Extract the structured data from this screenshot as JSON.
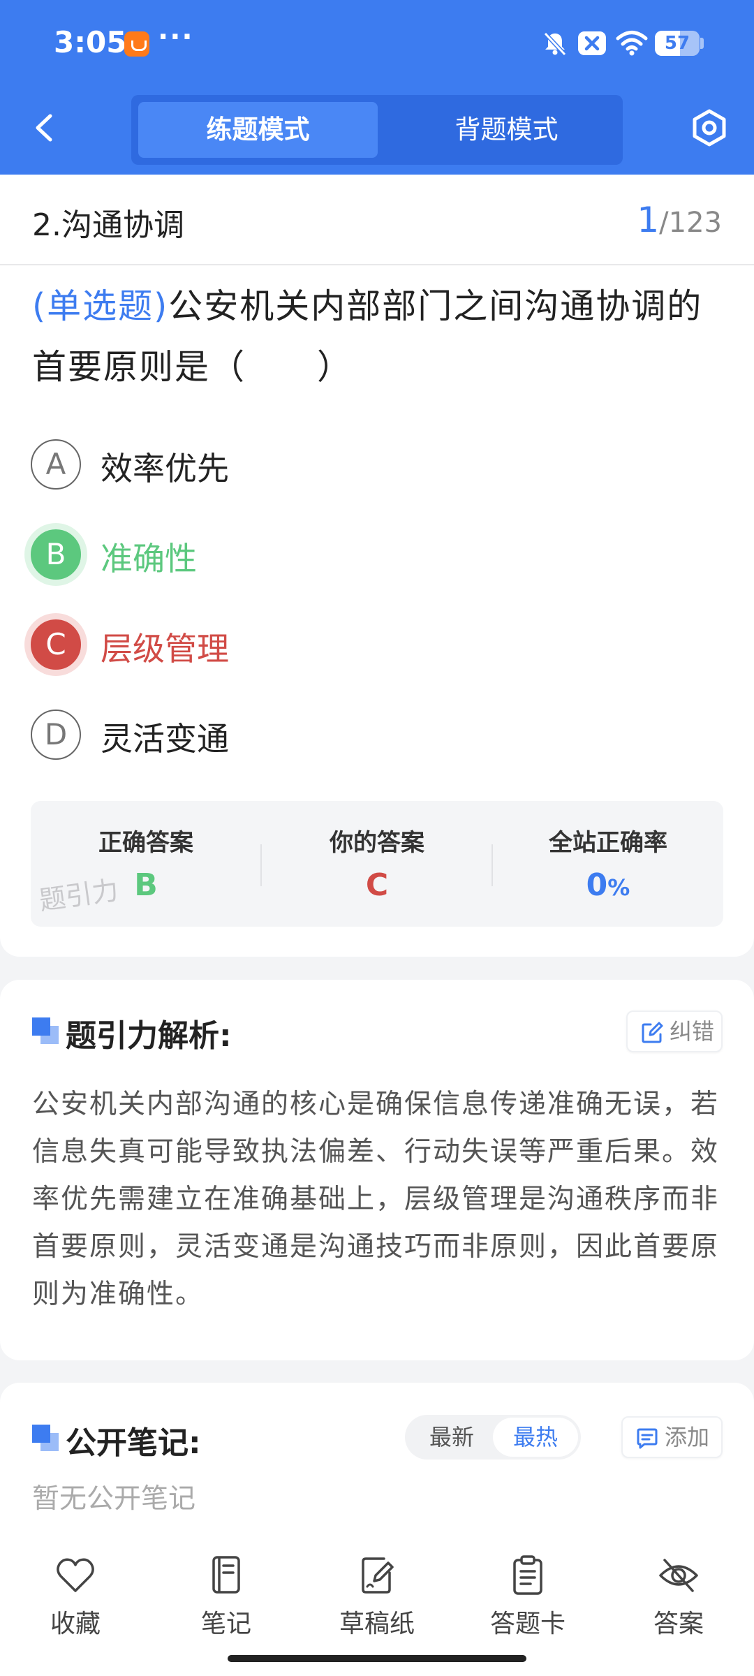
{
  "status_bar": {
    "time": "3:05",
    "more": "···",
    "battery_level": "57",
    "battery_fraction": 0.57
  },
  "header": {
    "tabs": [
      {
        "label": "练题模式",
        "active": true
      },
      {
        "label": "背题模式",
        "active": false
      }
    ],
    "accent": "#3d7cf0"
  },
  "question": {
    "category": "2.沟通协调",
    "current": "1",
    "total": "/123",
    "type": "(单选题)",
    "text": "公安机关内部部门之间沟通协调的首要原则是（　　）",
    "options": [
      {
        "letter": "A",
        "text": "效率优先",
        "state": "normal"
      },
      {
        "letter": "B",
        "text": "准确性",
        "state": "correct"
      },
      {
        "letter": "C",
        "text": "层级管理",
        "state": "wrong"
      },
      {
        "letter": "D",
        "text": "灵活变通",
        "state": "normal"
      }
    ]
  },
  "answers": {
    "correct_label": "正确答案",
    "correct_value": "B",
    "yours_label": "你的答案",
    "yours_value": "C",
    "rate_label": "全站正确率",
    "rate_value": "0",
    "rate_unit": "%",
    "watermark": "题引力",
    "colors": {
      "correct": "#5cc87e",
      "wrong": "#d14b46",
      "rate": "#3d7cf0"
    }
  },
  "analysis": {
    "title": "题引力解析:",
    "report_label": "纠错",
    "text": "公安机关内部沟通的核心是确保信息传递准确无误，若信息失真可能导致执法偏差、行动失误等严重后果。效率优先需建立在准确基础上，层级管理是沟通秩序而非首要原则，灵活变通是沟通技巧而非原则，因此首要原则为准确性。"
  },
  "notes": {
    "title": "公开笔记:",
    "sort_latest": "最新",
    "sort_hot": "最热",
    "add_label": "添加",
    "empty": "暂无公开笔记"
  },
  "bottom_nav": [
    {
      "label": "收藏",
      "icon": "heart-icon"
    },
    {
      "label": "笔记",
      "icon": "notebook-icon"
    },
    {
      "label": "草稿纸",
      "icon": "draft-icon"
    },
    {
      "label": "答题卡",
      "icon": "clipboard-icon"
    },
    {
      "label": "答案",
      "icon": "eye-off-icon"
    }
  ]
}
